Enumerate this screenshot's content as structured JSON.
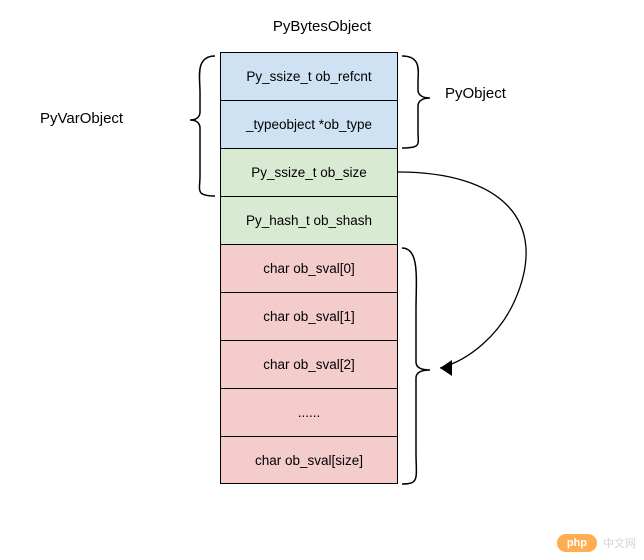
{
  "title": "PyBytesObject",
  "labels": {
    "pyvarobject": "PyVarObject",
    "pyobject": "PyObject"
  },
  "cells": [
    {
      "text": "Py_ssize_t ob_refcnt",
      "color": "blue"
    },
    {
      "text": "_typeobject *ob_type",
      "color": "blue"
    },
    {
      "text": "Py_ssize_t ob_size",
      "color": "green"
    },
    {
      "text": "Py_hash_t ob_shash",
      "color": "green"
    },
    {
      "text": "char ob_sval[0]",
      "color": "red"
    },
    {
      "text": "char ob_sval[1]",
      "color": "red"
    },
    {
      "text": "char ob_sval[2]",
      "color": "red"
    },
    {
      "text": "......",
      "color": "red"
    },
    {
      "text": "char ob_sval[size]",
      "color": "red"
    }
  ],
  "watermark": {
    "badge": "php",
    "text": "中文网"
  }
}
